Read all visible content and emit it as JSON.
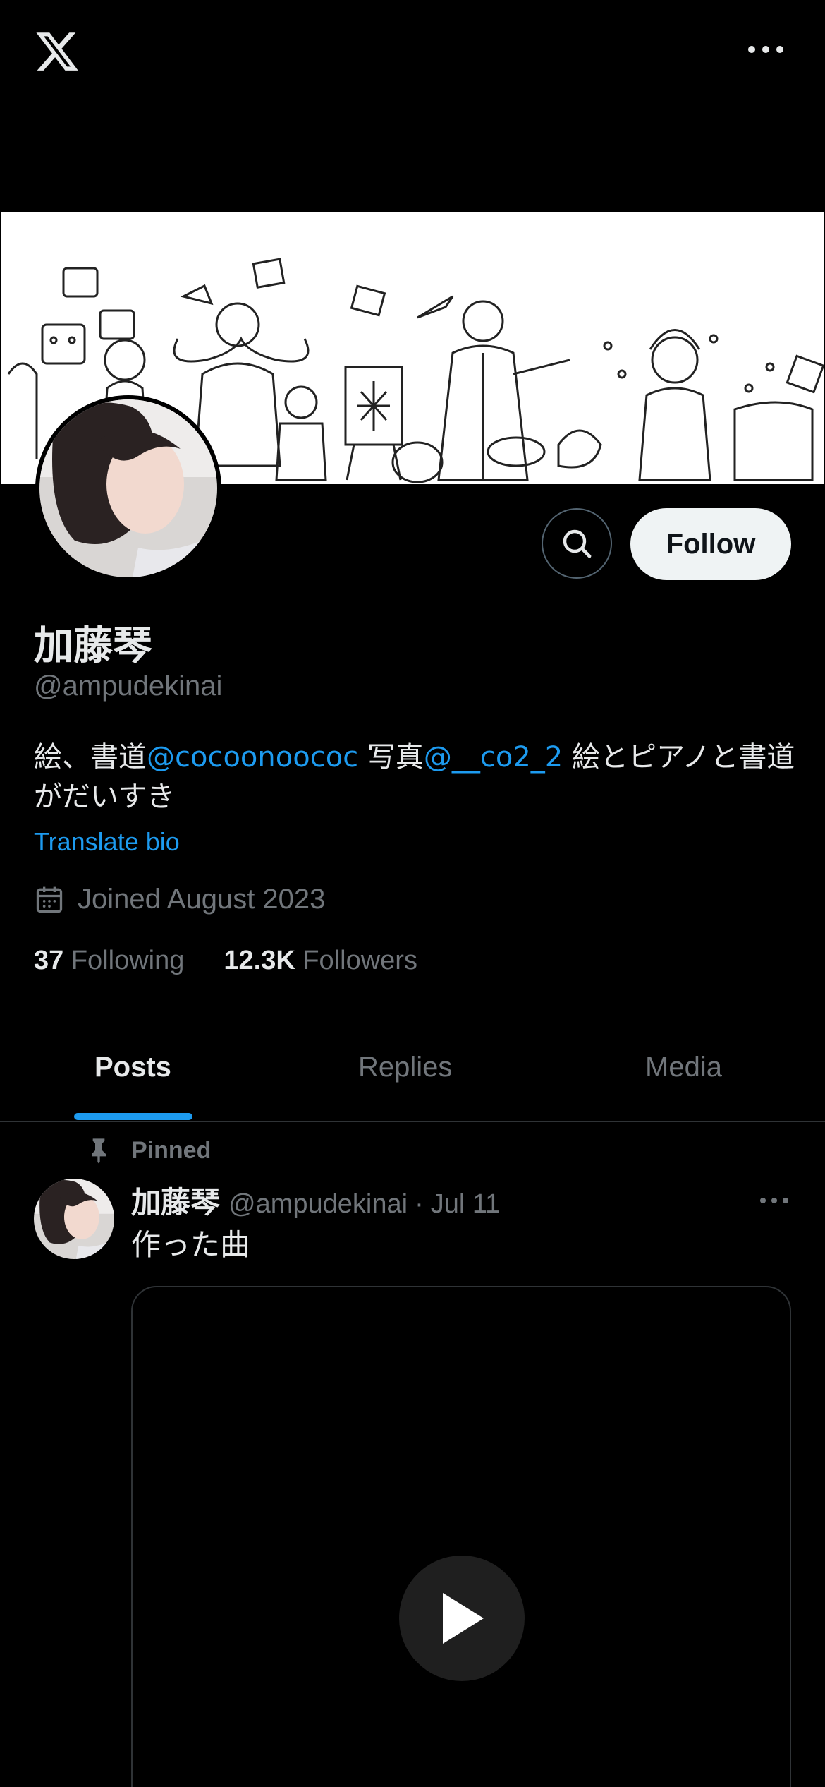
{
  "topbar": {
    "logo_icon": "x-logo-icon",
    "more_icon": "more-horizontal-icon"
  },
  "profile": {
    "display_name": "加藤琴",
    "handle": "@ampudekinai",
    "bio": {
      "part1": "絵、書道",
      "mention1": "@cocoonoococ",
      "part2": " 写真",
      "mention2": "@__co2_2",
      "part3": " 絵とピアノと書道がだいすき"
    },
    "translate_label": "Translate bio",
    "joined": "Joined August 2023",
    "following_count": "37",
    "following_label": "Following",
    "followers_count": "12.3K",
    "followers_label": "Followers"
  },
  "actions": {
    "follow_label": "Follow",
    "search_icon": "search-icon"
  },
  "tabs": [
    {
      "label": "Posts",
      "active": true
    },
    {
      "label": "Replies",
      "active": false
    },
    {
      "label": "Media",
      "active": false
    }
  ],
  "post": {
    "pinned_label": "Pinned",
    "author_name": "加藤琴",
    "author_handle": "@ampudekinai",
    "separator": "·",
    "date": "Jul 11",
    "text": "作った曲",
    "media_icon": "play-icon"
  },
  "colors": {
    "background": "#000000",
    "text_primary": "#e7e9ea",
    "text_secondary": "#71767b",
    "accent": "#1d9bf0",
    "follow_bg": "#eff3f4",
    "border": "#2f3336"
  }
}
